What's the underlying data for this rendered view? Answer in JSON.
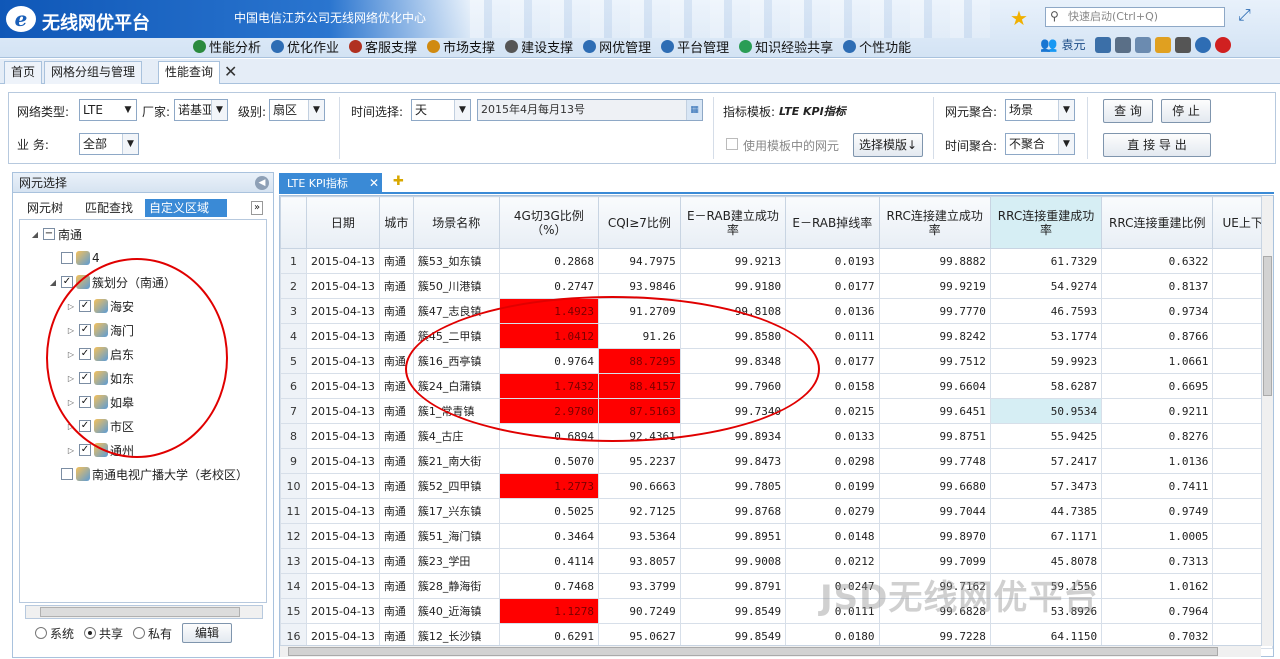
{
  "header": {
    "logo_text": "无线网优平台",
    "org_text": "中国电信江苏公司无线网络优化中心",
    "quick_search_placeholder": "快速启动(Ctrl+Q)",
    "user_name": "袁元",
    "menu": [
      "性能分析",
      "优化作业",
      "客服支撑",
      "市场支撑",
      "建设支撑",
      "网优管理",
      "平台管理",
      "知识经验共享",
      "个性功能"
    ]
  },
  "tabs": [
    "首页",
    "网格分组与管理",
    "性能查询"
  ],
  "filters": {
    "net_type_label": "网络类型:",
    "net_type": "LTE",
    "vendor_label": "厂家:",
    "vendor": "诺基亚",
    "level_label": "级别:",
    "level": "扇区",
    "time_label": "时间选择:",
    "time_unit": "天",
    "time_value": "2015年4月每月13号",
    "business_label": "业    务:",
    "business": "全部",
    "template_label": "指标模板:",
    "template_value": "LTE KPI指标",
    "use_template_label": "使用模板中的网元",
    "choose_template": "选择模版↓",
    "ne_agg_label": "网元聚合:",
    "ne_agg": "场景",
    "time_agg_label": "时间聚合:",
    "time_agg": "不聚合",
    "query": "查 询",
    "stop": "停 止",
    "export": "直 接 导 出"
  },
  "left_panel": {
    "title": "网元选择",
    "subtabs": [
      "网元树",
      "匹配查找",
      "自定义区域"
    ],
    "tree": [
      {
        "label": "南通",
        "level": 0,
        "tri": "◢",
        "cb": "−"
      },
      {
        "label": "4",
        "level": 1,
        "tri": "",
        "cb": ""
      },
      {
        "label": "簇划分（南通）",
        "level": 1,
        "tri": "◢",
        "cb": "✓"
      },
      {
        "label": "海安",
        "level": 2,
        "tri": "▷",
        "cb": "✓"
      },
      {
        "label": "海门",
        "level": 2,
        "tri": "▷",
        "cb": "✓"
      },
      {
        "label": "启东",
        "level": 2,
        "tri": "▷",
        "cb": "✓"
      },
      {
        "label": "如东",
        "level": 2,
        "tri": "▷",
        "cb": "✓"
      },
      {
        "label": "如皋",
        "level": 2,
        "tri": "▷",
        "cb": "✓"
      },
      {
        "label": "市区",
        "level": 2,
        "tri": "▷",
        "cb": "✓"
      },
      {
        "label": "通州",
        "level": 2,
        "tri": "▷",
        "cb": "✓"
      },
      {
        "label": "南通电视广播大学（老校区）",
        "level": 1,
        "tri": "",
        "cb": ""
      }
    ],
    "options": [
      "系统",
      "共享",
      "私有"
    ],
    "selected_option": "共享",
    "edit": "编辑"
  },
  "grid": {
    "tab": "LTE KPI指标",
    "columns": [
      "",
      "日期",
      "城市",
      "场景名称",
      "4G切3G比例（%）",
      "CQI≥7比例",
      "E－RAB建立成功率",
      "E－RAB掉线率",
      "RRC连接建立成功率",
      "RRC连接重建成功率",
      "RRC连接重建比例",
      "UE上下"
    ],
    "rows": [
      [
        "1",
        "2015-04-13",
        "南通",
        "簇53_如东镇",
        "0.2868",
        "94.7975",
        "99.9213",
        "0.0193",
        "99.8882",
        "61.7329",
        "0.6322"
      ],
      [
        "2",
        "2015-04-13",
        "南通",
        "簇50_川港镇",
        "0.2747",
        "93.9846",
        "99.9180",
        "0.0177",
        "99.9219",
        "54.9274",
        "0.8137"
      ],
      [
        "3",
        "2015-04-13",
        "南通",
        "簇47_志良镇",
        "1.4923",
        "91.2709",
        "99.8108",
        "0.0136",
        "99.7770",
        "46.7593",
        "0.9734"
      ],
      [
        "4",
        "2015-04-13",
        "南通",
        "簇45_二甲镇",
        "1.0412",
        "91.26",
        "99.8580",
        "0.0111",
        "99.8242",
        "53.1774",
        "0.8766"
      ],
      [
        "5",
        "2015-04-13",
        "南通",
        "簇16_西亭镇",
        "0.9764",
        "88.7295",
        "99.8348",
        "0.0177",
        "99.7512",
        "59.9923",
        "1.0661"
      ],
      [
        "6",
        "2015-04-13",
        "南通",
        "簇24_白蒲镇",
        "1.7432",
        "88.4157",
        "99.7960",
        "0.0158",
        "99.6604",
        "58.6287",
        "0.6695"
      ],
      [
        "7",
        "2015-04-13",
        "南通",
        "簇1_常青镇",
        "2.9780",
        "87.5163",
        "99.7340",
        "0.0215",
        "99.6451",
        "50.9534",
        "0.9211"
      ],
      [
        "8",
        "2015-04-13",
        "南通",
        "簇4_古庄",
        "0.6894",
        "92.4361",
        "99.8934",
        "0.0133",
        "99.8751",
        "55.9425",
        "0.8276"
      ],
      [
        "9",
        "2015-04-13",
        "南通",
        "簇21_南大街",
        "0.5070",
        "95.2237",
        "99.8473",
        "0.0298",
        "99.7748",
        "57.2417",
        "1.0136"
      ],
      [
        "10",
        "2015-04-13",
        "南通",
        "簇52_四甲镇",
        "1.2773",
        "90.6663",
        "99.7805",
        "0.0199",
        "99.6680",
        "57.3473",
        "0.7411"
      ],
      [
        "11",
        "2015-04-13",
        "南通",
        "簇17_兴东镇",
        "0.5025",
        "92.7125",
        "99.8768",
        "0.0279",
        "99.7044",
        "44.7385",
        "0.9749"
      ],
      [
        "12",
        "2015-04-13",
        "南通",
        "簇51_海门镇",
        "0.3464",
        "93.5364",
        "99.8951",
        "0.0148",
        "99.8970",
        "67.1171",
        "1.0005"
      ],
      [
        "13",
        "2015-04-13",
        "南通",
        "簇23_学田",
        "0.4114",
        "93.8057",
        "99.9008",
        "0.0212",
        "99.7099",
        "45.8078",
        "0.7313"
      ],
      [
        "14",
        "2015-04-13",
        "南通",
        "簇28_静海街",
        "0.7468",
        "93.3799",
        "99.8791",
        "0.0247",
        "99.7162",
        "59.1556",
        "1.0162"
      ],
      [
        "15",
        "2015-04-13",
        "南通",
        "簇40_近海镇",
        "1.1278",
        "90.7249",
        "99.8549",
        "0.0111",
        "99.6828",
        "53.8926",
        "0.7964"
      ],
      [
        "16",
        "2015-04-13",
        "南通",
        "簇12_长沙镇",
        "0.6291",
        "95.0627",
        "99.8549",
        "0.0180",
        "99.7228",
        "64.1150",
        "0.7032"
      ]
    ],
    "red_4g": [
      "3",
      "4",
      "6",
      "7",
      "10",
      "15"
    ],
    "red_cqi": [
      "5",
      "6",
      "7"
    ],
    "light": [
      "7"
    ]
  },
  "watermark": "JSD无线网优平台",
  "colors": {
    "accent": "#3a8ad6",
    "alert": "#ff0000",
    "header": "#1a5fb8"
  }
}
